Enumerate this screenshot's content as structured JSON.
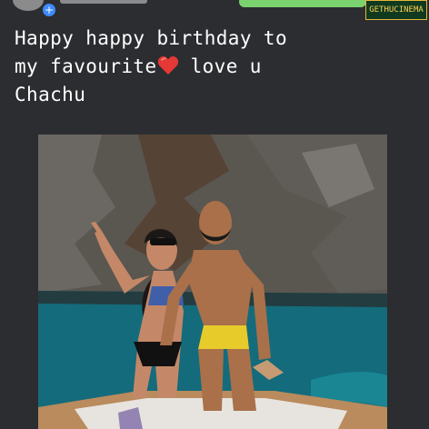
{
  "header": {
    "avatar_icon": "avatar",
    "add_badge_icon": "plus-icon",
    "watermark_text": "GETHUCINEMA"
  },
  "post": {
    "caption_line1": "Happy happy birthday to",
    "caption_line2_prefix": "my favourite",
    "caption_line2_suffix": " love u",
    "caption_line3": "Chachu",
    "heart_icon": "heart-icon"
  },
  "photo": {
    "description_icon": "photo"
  },
  "colors": {
    "background": "#2b2d31",
    "caption_text": "#ffffff",
    "watermark_bg": "#0f3a20",
    "watermark_text": "#ffd04d",
    "accent_bar": "#7bd36f"
  }
}
